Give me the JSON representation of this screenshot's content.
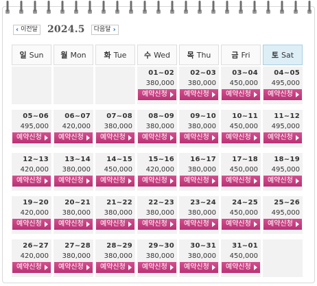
{
  "nav": {
    "prev_label": "이전달",
    "next_label": "다음달",
    "month_title": "2024.5"
  },
  "weekdays": [
    {
      "ko": "일",
      "en": "Sun"
    },
    {
      "ko": "월",
      "en": "Mon"
    },
    {
      "ko": "화",
      "en": "Tue"
    },
    {
      "ko": "수",
      "en": "Wed"
    },
    {
      "ko": "목",
      "en": "Thu"
    },
    {
      "ko": "금",
      "en": "Fri"
    },
    {
      "ko": "토",
      "en": "Sat"
    }
  ],
  "book_label": "예약신청",
  "weeks": [
    [
      null,
      null,
      null,
      {
        "date": "01~02",
        "price": "380,000"
      },
      {
        "date": "02~03",
        "price": "380,000"
      },
      {
        "date": "03~04",
        "price": "450,000"
      },
      {
        "date": "04~05",
        "price": "495,000"
      }
    ],
    [
      {
        "date": "05~06",
        "price": "495,000"
      },
      {
        "date": "06~07",
        "price": "420,000"
      },
      {
        "date": "07~08",
        "price": "380,000"
      },
      {
        "date": "08~09",
        "price": "380,000"
      },
      {
        "date": "09~10",
        "price": "380,000"
      },
      {
        "date": "10~11",
        "price": "450,000"
      },
      {
        "date": "11~12",
        "price": "495,000"
      }
    ],
    [
      {
        "date": "12~13",
        "price": "420,000"
      },
      {
        "date": "13~14",
        "price": "380,000"
      },
      {
        "date": "14~15",
        "price": "450,000"
      },
      {
        "date": "15~16",
        "price": "420,000"
      },
      {
        "date": "16~17",
        "price": "380,000"
      },
      {
        "date": "17~18",
        "price": "450,000"
      },
      {
        "date": "18~19",
        "price": "495,000"
      }
    ],
    [
      {
        "date": "19~20",
        "price": "420,000"
      },
      {
        "date": "20~21",
        "price": "380,000"
      },
      {
        "date": "21~22",
        "price": "380,000"
      },
      {
        "date": "22~23",
        "price": "380,000"
      },
      {
        "date": "23~24",
        "price": "380,000"
      },
      {
        "date": "24~25",
        "price": "450,000"
      },
      {
        "date": "25~26",
        "price": "495,000"
      }
    ],
    [
      {
        "date": "26~27",
        "price": "420,000"
      },
      {
        "date": "27~28",
        "price": "380,000"
      },
      {
        "date": "28~29",
        "price": "380,000"
      },
      {
        "date": "29~30",
        "price": "380,000"
      },
      {
        "date": "30~31",
        "price": "380,000"
      },
      {
        "date": "31~01",
        "price": "450,000"
      },
      null
    ]
  ],
  "colors": {
    "book_button": "#c23f80",
    "saturday_header": "#ddeef7",
    "nav_arrow": "#2e6fb6",
    "cell_bg": "#f2f2f2"
  }
}
